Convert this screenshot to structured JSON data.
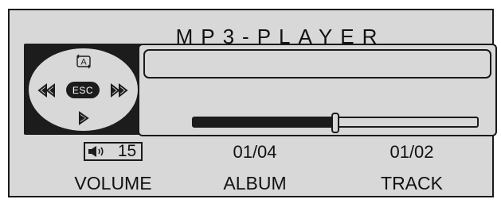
{
  "title": "MP3-PLAYER",
  "nav": {
    "top_label": "A",
    "esc_label": "ESC",
    "icons": {
      "top": "rotate-a-icon",
      "left": "rewind-icon",
      "right": "fast-forward-icon",
      "bottom": "play-icon"
    }
  },
  "display": {
    "text": ""
  },
  "progress": {
    "fraction": 0.5
  },
  "volume": {
    "value": "15",
    "label": "VOLUME",
    "icon": "speaker-icon"
  },
  "album": {
    "value": "01/04",
    "label": "ALBUM"
  },
  "track": {
    "value": "01/02",
    "label": "TRACK"
  },
  "colors": {
    "background": "#d8d8d8",
    "foreground": "#1c1c1c"
  }
}
